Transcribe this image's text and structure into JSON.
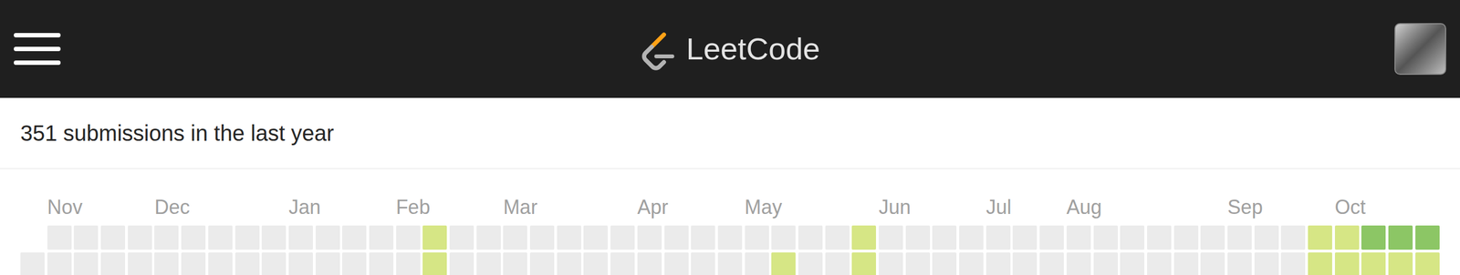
{
  "logo": {
    "text": "LeetCode"
  },
  "summary": "351 submissions in the last year",
  "calendar": {
    "months": [
      {
        "label": "Nov",
        "week": 1
      },
      {
        "label": "Dec",
        "week": 5
      },
      {
        "label": "Jan",
        "week": 10
      },
      {
        "label": "Feb",
        "week": 14
      },
      {
        "label": "Mar",
        "week": 18
      },
      {
        "label": "Apr",
        "week": 23
      },
      {
        "label": "May",
        "week": 27
      },
      {
        "label": "Jun",
        "week": 32
      },
      {
        "label": "Jul",
        "week": 36
      },
      {
        "label": "Aug",
        "week": 39
      },
      {
        "label": "Sep",
        "week": 45
      },
      {
        "label": "Oct",
        "week": 49
      }
    ],
    "rows": [
      {
        "levels": [
          null,
          0,
          0,
          0,
          0,
          0,
          0,
          0,
          0,
          0,
          0,
          0,
          0,
          0,
          0,
          0.5,
          0,
          0,
          0,
          0,
          0,
          0,
          0,
          0,
          0,
          0,
          0,
          0,
          0,
          0,
          0,
          0.5,
          0,
          0,
          0,
          0,
          0,
          0,
          0,
          0,
          0,
          0,
          0,
          0,
          0,
          0,
          0,
          0,
          0.5,
          0.5,
          1,
          1,
          1
        ]
      },
      {
        "levels": [
          0,
          0,
          0,
          0,
          0,
          0,
          0,
          0,
          0,
          0,
          0,
          0,
          0,
          0,
          0,
          0.5,
          0,
          0,
          0,
          0,
          0,
          0,
          0,
          0,
          0,
          0,
          0,
          0,
          0.5,
          0,
          0,
          0.5,
          0,
          0,
          0,
          0,
          0,
          0,
          0,
          0,
          0,
          0,
          0,
          0,
          0,
          0,
          0,
          0,
          0.5,
          0.5,
          0.5,
          0.5,
          0.5
        ]
      }
    ]
  }
}
